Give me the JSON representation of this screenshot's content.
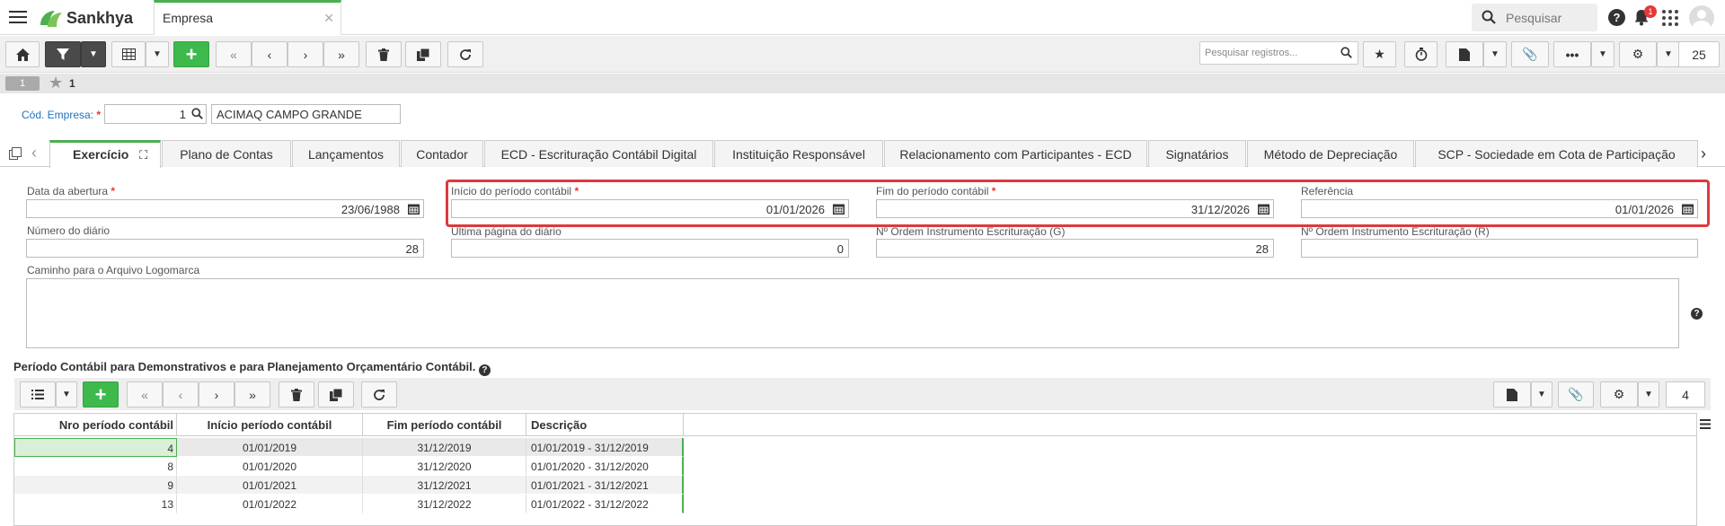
{
  "app": {
    "name": "Sankhya",
    "tab_title": "Empresa",
    "search_placeholder": "Pesquisar",
    "notification_count": "1"
  },
  "toolbar": {
    "search_records_placeholder": "Pesquisar registros...",
    "page_size": "25"
  },
  "record_nav": {
    "index": "1",
    "count": "1"
  },
  "header": {
    "cod_empresa_label": "Cód. Empresa:",
    "cod_empresa_value": "1",
    "empresa_name": "ACIMAQ CAMPO GRANDE"
  },
  "tabs": [
    {
      "label": "Exercício"
    },
    {
      "label": "Plano de Contas"
    },
    {
      "label": "Lançamentos"
    },
    {
      "label": "Contador"
    },
    {
      "label": "ECD - Escrituração Contábil Digital"
    },
    {
      "label": "Instituição Responsável"
    },
    {
      "label": "Relacionamento com Participantes - ECD"
    },
    {
      "label": "Signatários"
    },
    {
      "label": "Método de Depreciação"
    },
    {
      "label": "SCP - Sociedade em Cota de Participação"
    }
  ],
  "form": {
    "data_abertura": {
      "label": "Data da abertura",
      "value": "23/06/1988"
    },
    "inicio_periodo": {
      "label": "Início do período contábil",
      "value": "01/01/2026"
    },
    "fim_periodo": {
      "label": "Fim do período contábil",
      "value": "31/12/2026"
    },
    "referencia": {
      "label": "Referência",
      "value": "01/01/2026"
    },
    "numero_diario": {
      "label": "Número do diário",
      "value": "28"
    },
    "ultima_pagina": {
      "label": "Última página do diário",
      "value": "0"
    },
    "ordem_g": {
      "label": "Nº Ordem Instrumento Escrituração (G)",
      "value": "28"
    },
    "ordem_r": {
      "label": "Nº Ordem Instrumento Escrituração (R)",
      "value": ""
    },
    "caminho_logo": {
      "label": "Caminho para o Arquivo Logomarca",
      "value": ""
    }
  },
  "section": {
    "title": "Período Contábil para Demonstrativos e para Planejamento Orçamentário Contábil."
  },
  "grid": {
    "page_size": "4",
    "columns": [
      "Nro período contábil",
      "Início período contábil",
      "Fim período contábil",
      "Descrição"
    ],
    "rows": [
      [
        "4",
        "01/01/2019",
        "31/12/2019",
        "01/01/2019 - 31/12/2019"
      ],
      [
        "8",
        "01/01/2020",
        "31/12/2020",
        "01/01/2020 - 31/12/2020"
      ],
      [
        "9",
        "01/01/2021",
        "31/12/2021",
        "01/01/2021 - 31/12/2021"
      ],
      [
        "13",
        "01/01/2022",
        "31/12/2022",
        "01/01/2022 - 31/12/2022"
      ]
    ]
  },
  "colors": {
    "accent_green": "#3eb94c",
    "highlight_red": "#e0383e",
    "link_blue": "#1e73be"
  }
}
